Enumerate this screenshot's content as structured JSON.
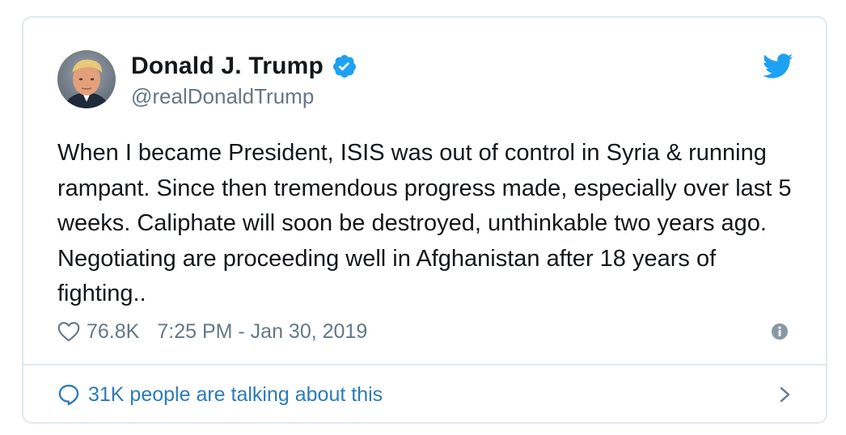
{
  "user": {
    "display_name": "Donald J. Trump",
    "handle": "@realDonaldTrump",
    "verified": true
  },
  "tweet": {
    "text": "When I became President, ISIS was out of control in Syria & running rampant. Since then tremendous progress made, especially over last 5 weeks. Caliphate will soon be destroyed, unthinkable two years ago. Negotiating are proceeding well in Afghanistan after 18 years of fighting..",
    "like_count": "76.8K",
    "timestamp": "7:25 PM - Jan 30, 2019"
  },
  "conversation": {
    "label": "31K people are talking about this"
  },
  "icons": {
    "brand": "twitter-bird-icon",
    "verified": "verified-badge-icon",
    "like": "heart-icon",
    "info": "info-icon",
    "reply": "speech-bubble-icon",
    "open": "chevron-right-icon"
  },
  "colors": {
    "twitter_blue": "#1da1f2",
    "link_blue": "#2b7bb9",
    "text": "#14171a",
    "secondary_text": "#657786",
    "border": "#e1e8ed"
  }
}
